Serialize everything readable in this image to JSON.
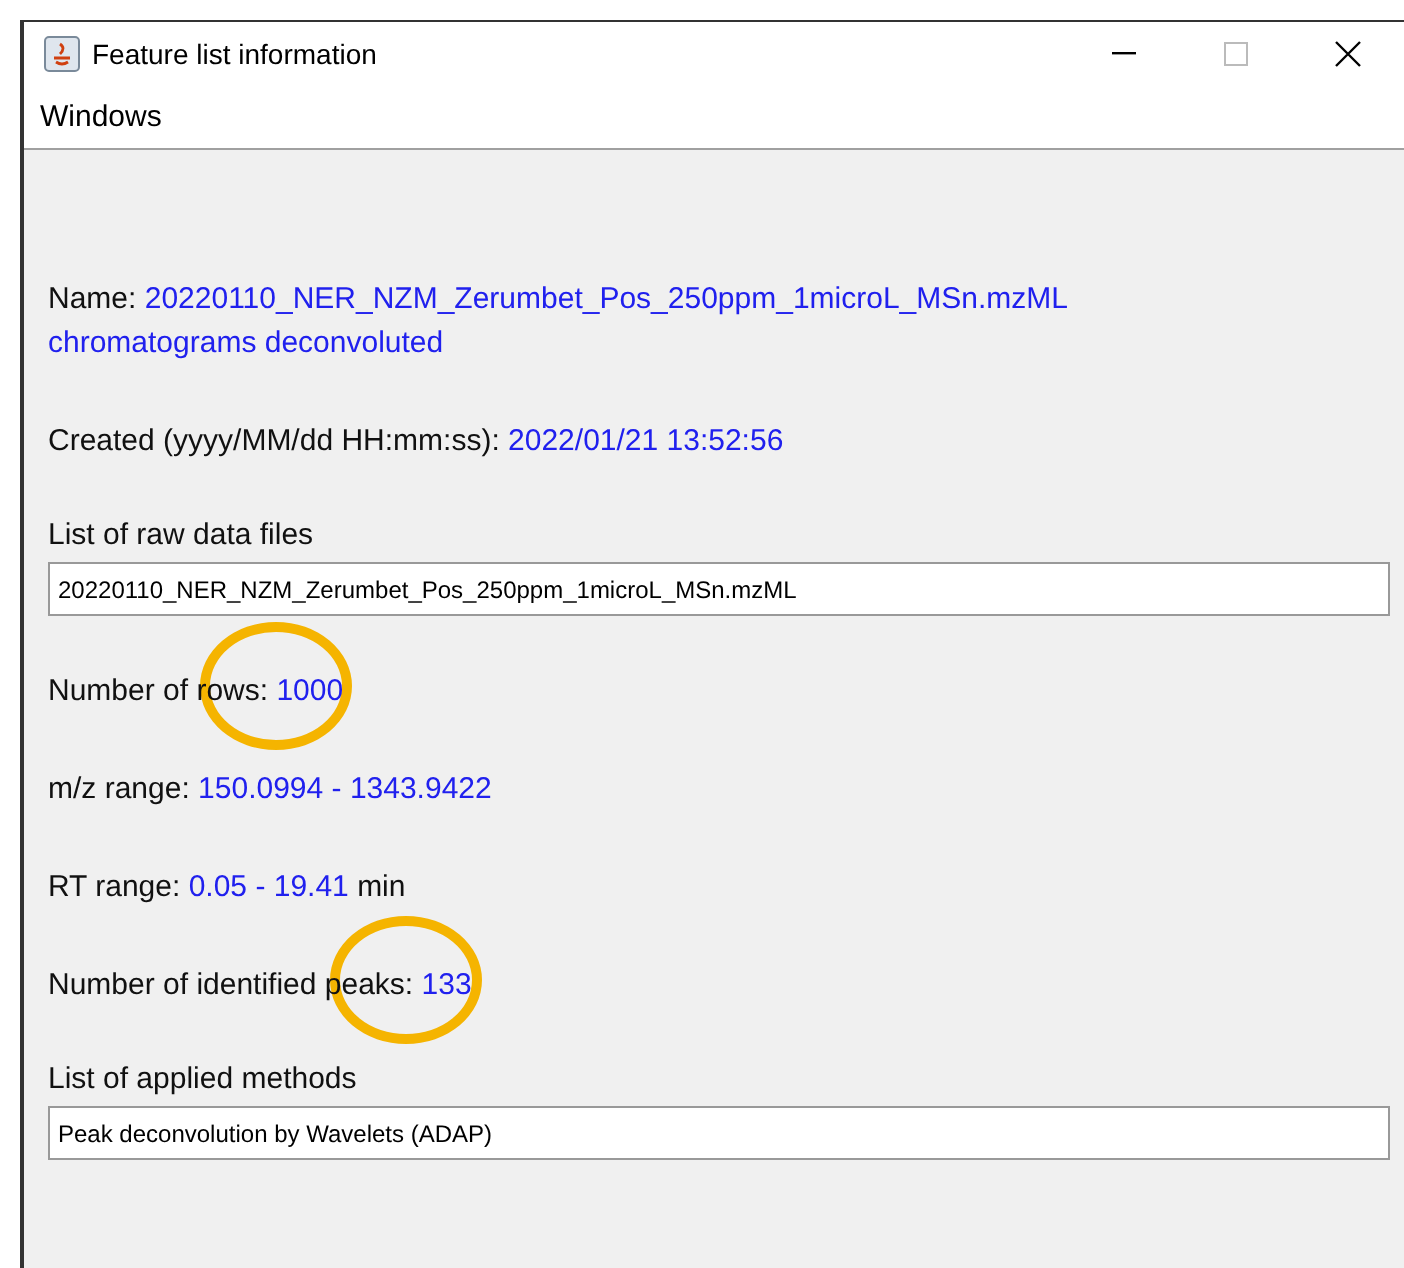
{
  "window": {
    "title": "Feature list information"
  },
  "menu": [
    "Windows"
  ],
  "info": [
    {
      "kind": "pair",
      "label": "Name:",
      "value": "20220110_NER_NZM_Zerumbet_Pos_250ppm_1microL_MSn.mzML chromatograms deconvoluted"
    },
    {
      "kind": "pair",
      "label": "Created (yyyy/MM/dd HH:mm:ss):",
      "value": "2022/01/21 13:52:56"
    },
    {
      "kind": "list",
      "label": "List of raw data files",
      "value": "20220110_NER_NZM_Zerumbet_Pos_250ppm_1microL_MSn.mzML"
    },
    {
      "kind": "pair",
      "label": "Number of rows:",
      "value": "1000",
      "circled": true
    },
    {
      "kind": "pair",
      "label": "m/z range:",
      "value": "150.0994 - 1343.9422"
    },
    {
      "kind": "pair",
      "label": "RT range:",
      "value": "0.05 - 19.41",
      "unit": "min"
    },
    {
      "kind": "pair",
      "label": "Number of identified peaks:",
      "value": "133",
      "circled": true
    },
    {
      "kind": "list",
      "label": "List of applied methods",
      "value": "Peak deconvolution by Wavelets (ADAP)"
    }
  ]
}
